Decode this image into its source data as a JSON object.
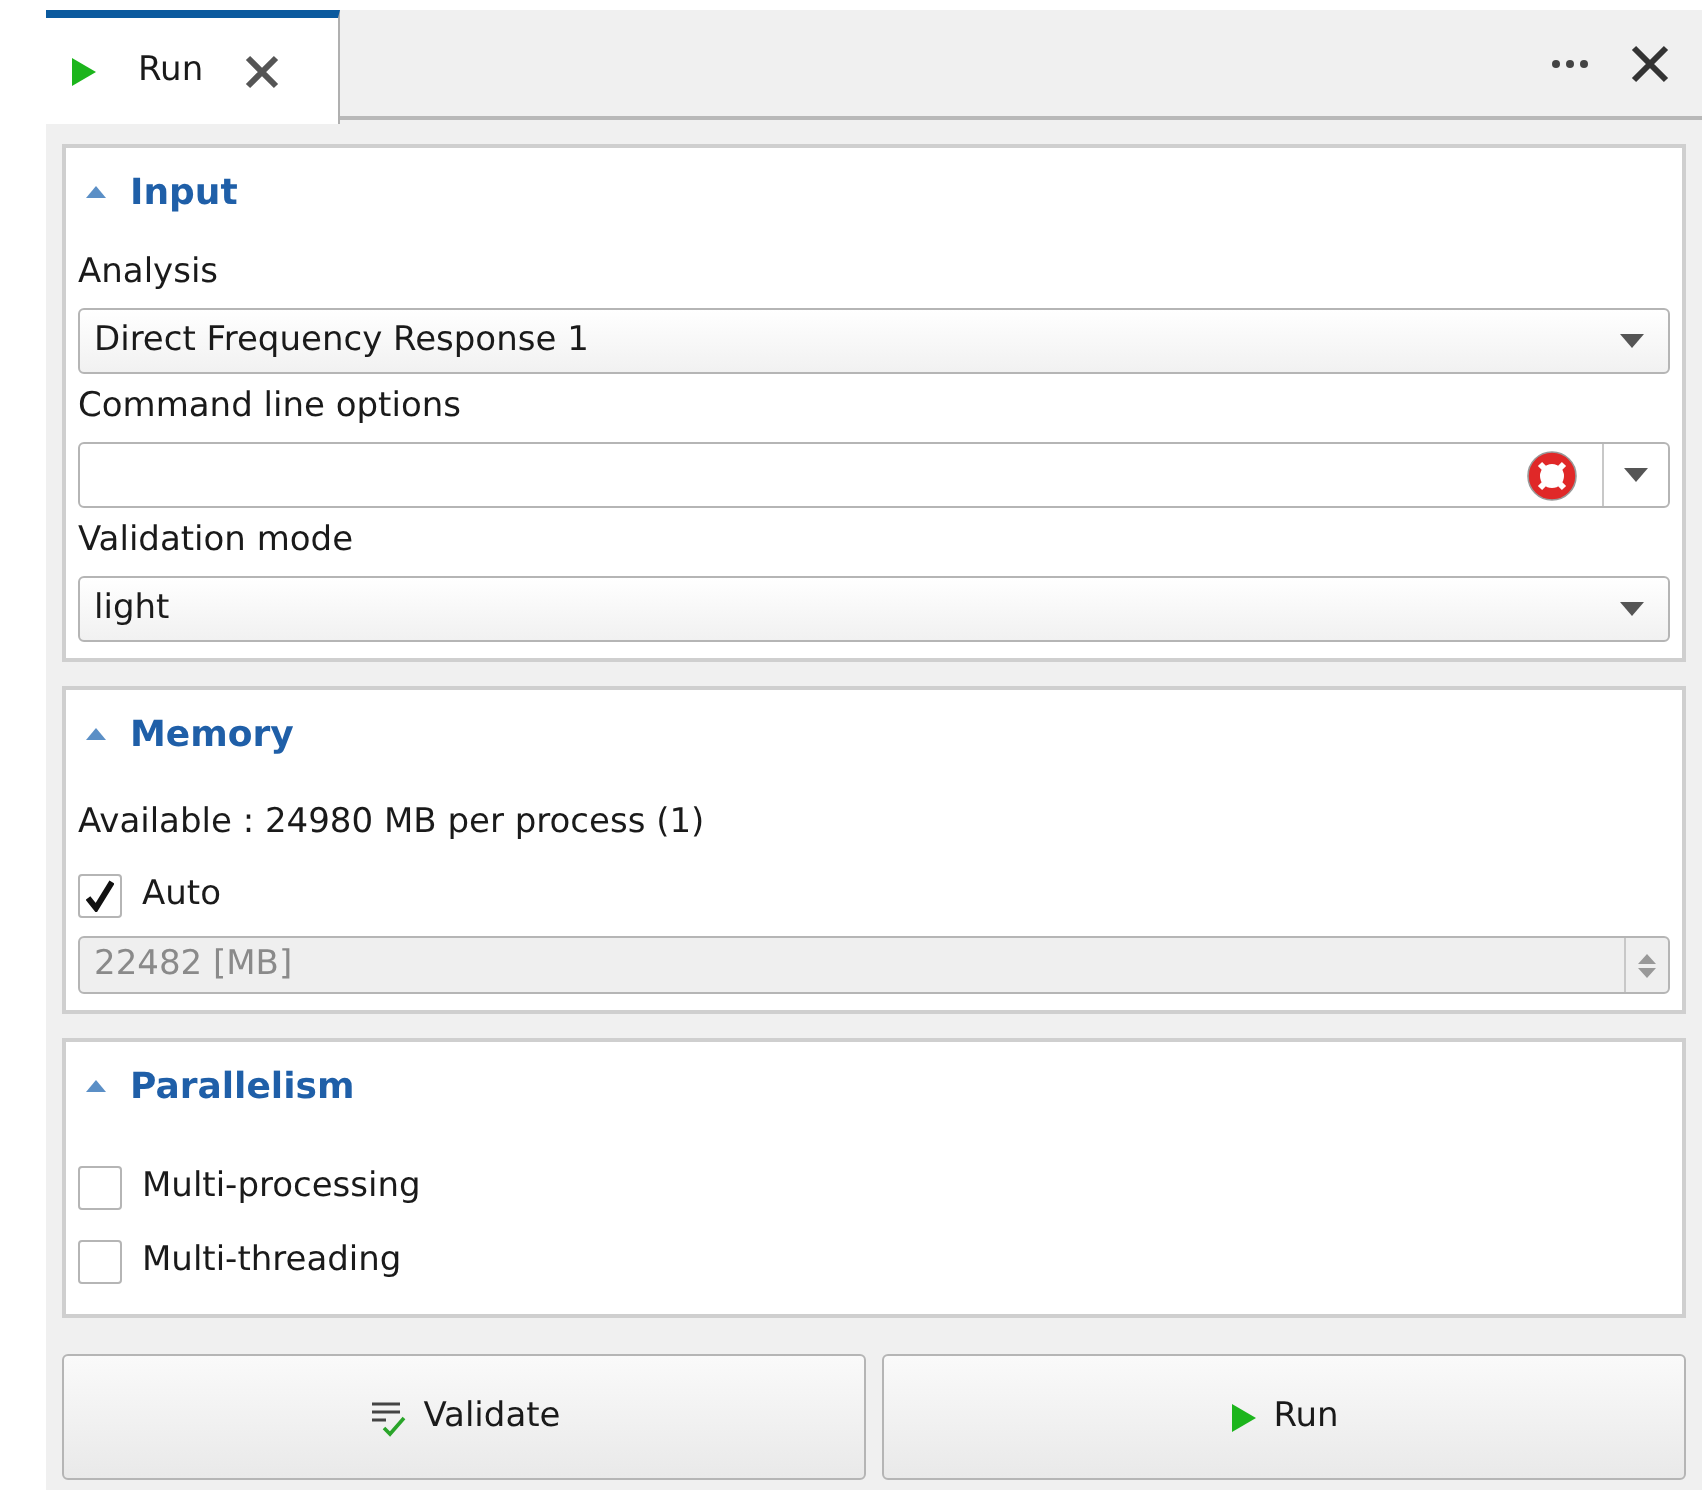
{
  "tabs": [
    {
      "label": "Run",
      "selected": true
    }
  ],
  "sections": [
    {
      "title": "Input",
      "expanded": true,
      "items": [
        {
          "kind": "label",
          "text": "Analysis"
        },
        {
          "kind": "dropdown",
          "value": "Direct Frequency Response 1"
        },
        {
          "kind": "label",
          "text": "Command line options"
        },
        {
          "kind": "combo_input"
        },
        {
          "kind": "label",
          "text": "Validation mode"
        },
        {
          "kind": "dropdown",
          "value": "light"
        }
      ]
    },
    {
      "title": "Memory",
      "expanded": true,
      "items": [
        {
          "kind": "label",
          "text": "Available : 24980 MB per process (1)"
        },
        {
          "kind": "checkbox",
          "label": "Auto",
          "checked": true
        },
        {
          "kind": "spinbox",
          "value": "22482 [MB]",
          "disabled": true
        }
      ]
    },
    {
      "title": "Parallelism",
      "expanded": true,
      "items": [
        {
          "kind": "checkbox",
          "label": "Multi-processing",
          "checked": false
        },
        {
          "kind": "checkbox",
          "label": "Multi-threading",
          "checked": false
        }
      ]
    }
  ],
  "buttons": [
    {
      "kind": "validate",
      "label": "Validate"
    },
    {
      "kind": "run",
      "label": "Run"
    }
  ]
}
